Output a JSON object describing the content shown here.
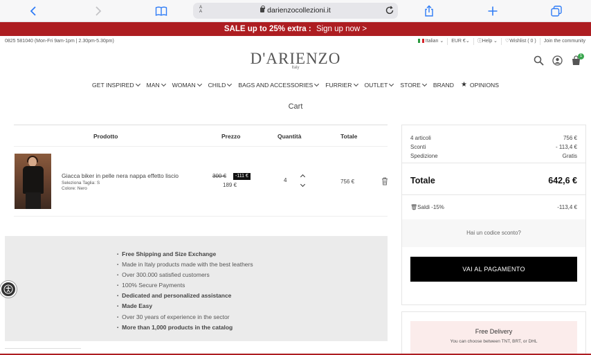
{
  "browser": {
    "text_size_label": "A",
    "url": "darienzocollezioni.it"
  },
  "promo": {
    "text": "SALE up to 25% extra :",
    "link": "Sign up now >"
  },
  "utility": {
    "phone_hours": "0825 581040 (Mon-Fri 9am-1pm | 2.30pm-5.30pm)",
    "language": "Italian",
    "currency": "EUR €",
    "help": "Help",
    "wishlist": "Wishlist ( 0 )",
    "community": "Join the community"
  },
  "logo": {
    "name": "D'ARIENZO",
    "sub": "Italy"
  },
  "cart_badge": "1",
  "nav": [
    {
      "label": "GET INSPIRED",
      "chevron": true
    },
    {
      "label": "MAN",
      "chevron": true
    },
    {
      "label": "WOMAN",
      "chevron": true
    },
    {
      "label": "CHILD",
      "chevron": true
    },
    {
      "label": "BAGS AND ACCESSORIES",
      "chevron": true
    },
    {
      "label": "FURRIER",
      "chevron": true
    },
    {
      "label": "OUTLET",
      "chevron": true
    },
    {
      "label": "STORE",
      "chevron": true
    },
    {
      "label": "BRAND",
      "chevron": false
    },
    {
      "label": "OPINIONS",
      "chevron": false,
      "star": true
    }
  ],
  "cart": {
    "title": "Cart",
    "headers": {
      "product": "Prodotto",
      "price": "Prezzo",
      "qty": "Quantità",
      "total": "Totale"
    },
    "item": {
      "name": "Giacca biker in pelle nera nappa effetto liscio",
      "size": "Seleziona Taglia: S",
      "color": "Colore: Nero",
      "price_old": "300 €",
      "discount": "-111 €",
      "price_new": "189 €",
      "qty": "4",
      "total": "756 €"
    }
  },
  "benefits": [
    {
      "text": "Free Shipping and Size Exchange",
      "bold": true
    },
    {
      "text": "Made in Italy products made with the best leathers",
      "bold": false
    },
    {
      "text": "Over 300.000 satisfied customers",
      "bold": false
    },
    {
      "text": "100% Secure Payments",
      "bold": false
    },
    {
      "text": "Dedicated and personalized assistance",
      "bold": true
    },
    {
      "text": "Made Easy",
      "bold": true
    },
    {
      "text": "Over 30 years of experience in the sector",
      "bold": false
    },
    {
      "text": "More than 1,000 products in the catalog",
      "bold": true
    }
  ],
  "summary": {
    "articles_label": "4 articoli",
    "articles_value": "756 €",
    "discount_label": "Sconti",
    "discount_value": "- 113,4 €",
    "shipping_label": "Spedizione",
    "shipping_value": "Gratis",
    "total_label": "Totale",
    "total_value": "642,6 €",
    "promo_label": "Saldi -15%",
    "promo_value": "-113,4 €",
    "coupon": "Hai un codice sconto?",
    "pay_button": "VAI AL PAGAMENTO"
  },
  "delivery": {
    "title": "Free Delivery",
    "subtitle": "You can choose between TNT, BRT, or DHL"
  },
  "colors": {
    "brand_red": "#ad1d21",
    "pay_button": "#000000",
    "badge_green": "#3aa64f"
  }
}
